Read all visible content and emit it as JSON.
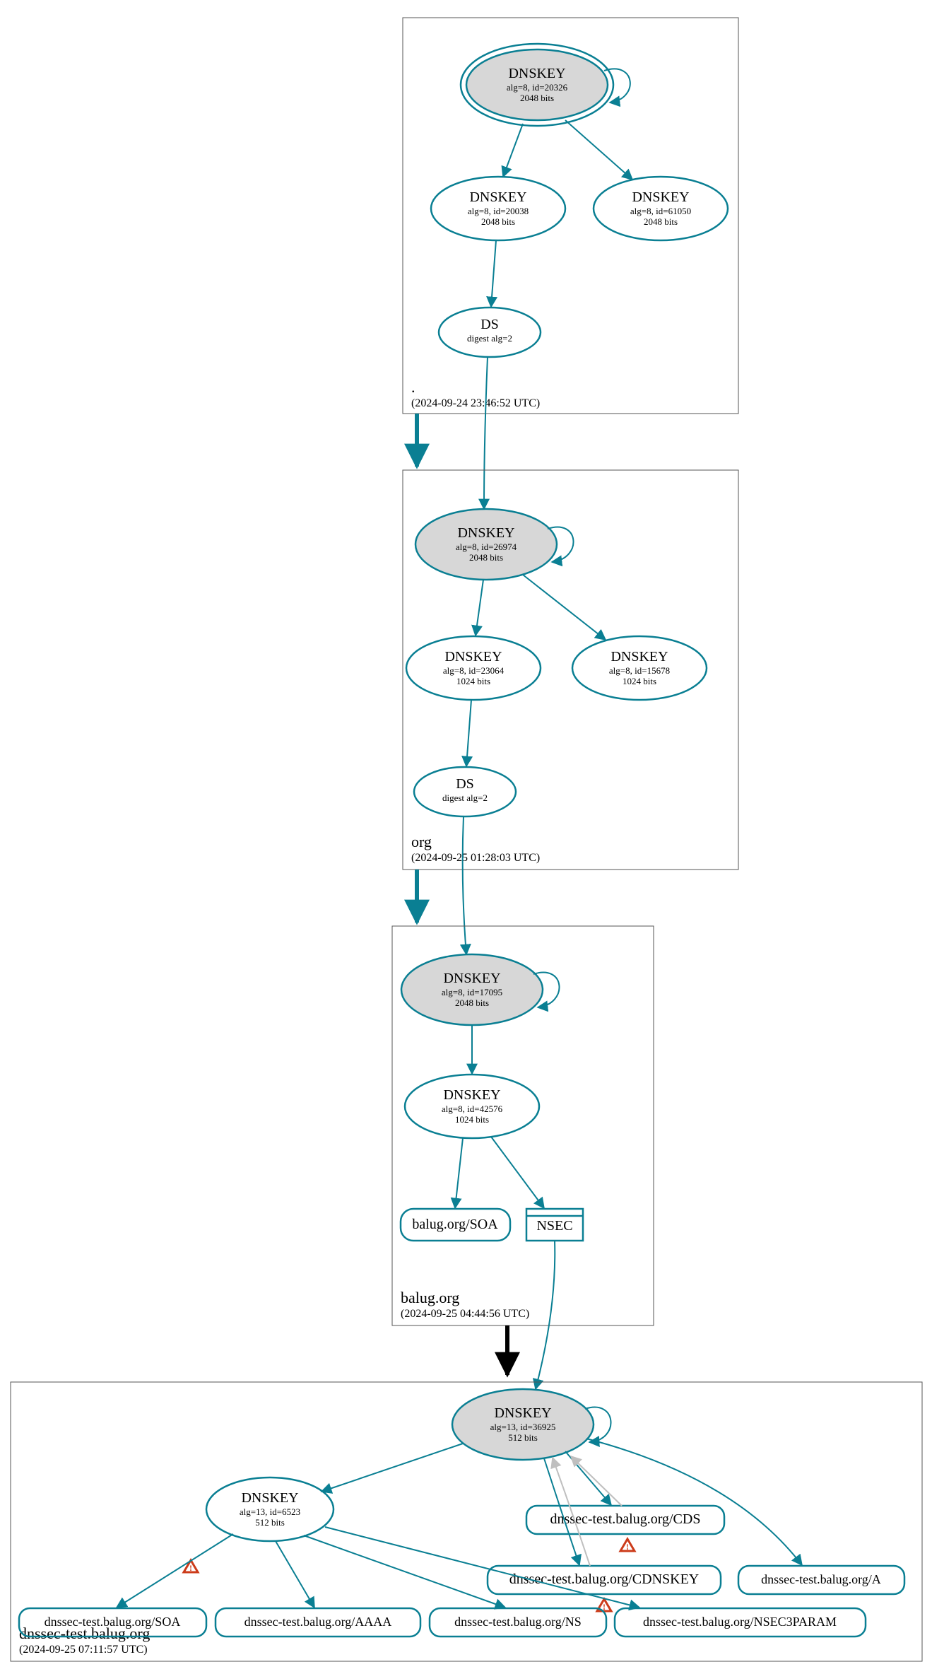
{
  "zones": {
    "root": {
      "label": ".",
      "timestamp": "(2024-09-24 23:46:52 UTC)"
    },
    "org": {
      "label": "org",
      "timestamp": "(2024-09-25 01:28:03 UTC)"
    },
    "balug": {
      "label": "balug.org",
      "timestamp": "(2024-09-25 04:44:56 UTC)"
    },
    "dnssec_test": {
      "label": "dnssec-test.balug.org",
      "timestamp": "(2024-09-25 07:11:57 UTC)"
    }
  },
  "nodes": {
    "root_ksk": {
      "title": "DNSKEY",
      "line2": "alg=8, id=20326",
      "line3": "2048 bits"
    },
    "root_zsk1": {
      "title": "DNSKEY",
      "line2": "alg=8, id=20038",
      "line3": "2048 bits"
    },
    "root_zsk2": {
      "title": "DNSKEY",
      "line2": "alg=8, id=61050",
      "line3": "2048 bits"
    },
    "root_ds": {
      "title": "DS",
      "line2": "digest alg=2"
    },
    "org_ksk": {
      "title": "DNSKEY",
      "line2": "alg=8, id=26974",
      "line3": "2048 bits"
    },
    "org_zsk1": {
      "title": "DNSKEY",
      "line2": "alg=8, id=23064",
      "line3": "1024 bits"
    },
    "org_zsk2": {
      "title": "DNSKEY",
      "line2": "alg=8, id=15678",
      "line3": "1024 bits"
    },
    "org_ds": {
      "title": "DS",
      "line2": "digest alg=2"
    },
    "balug_ksk": {
      "title": "DNSKEY",
      "line2": "alg=8, id=17095",
      "line3": "2048 bits"
    },
    "balug_zsk": {
      "title": "DNSKEY",
      "line2": "alg=8, id=42576",
      "line3": "1024 bits"
    },
    "balug_soa": {
      "title": "balug.org/SOA"
    },
    "balug_nsec": {
      "title": "NSEC"
    },
    "test_ksk": {
      "title": "DNSKEY",
      "line2": "alg=13, id=36925",
      "line3": "512 bits"
    },
    "test_zsk": {
      "title": "DNSKEY",
      "line2": "alg=13, id=6523",
      "line3": "512 bits"
    },
    "test_cds": {
      "title": "dnssec-test.balug.org/CDS"
    },
    "test_cdnskey": {
      "title": "dnssec-test.balug.org/CDNSKEY"
    },
    "test_soa": {
      "title": "dnssec-test.balug.org/SOA"
    },
    "test_aaaa": {
      "title": "dnssec-test.balug.org/AAAA"
    },
    "test_ns": {
      "title": "dnssec-test.balug.org/NS"
    },
    "test_nsec3param": {
      "title": "dnssec-test.balug.org/NSEC3PARAM"
    },
    "test_a": {
      "title": "dnssec-test.balug.org/A"
    }
  }
}
